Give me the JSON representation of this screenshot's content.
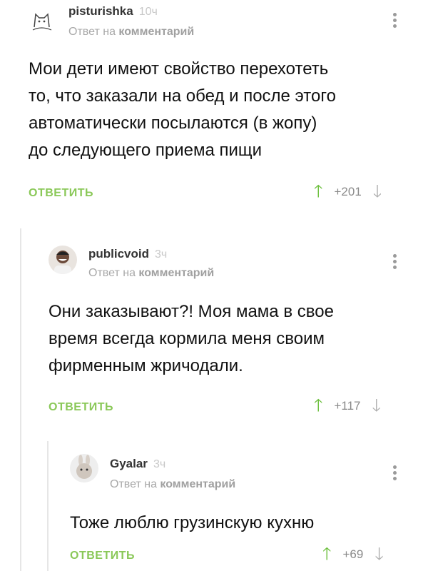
{
  "comments": [
    {
      "username": "pisturishka",
      "time": "10ч",
      "reply_prefix": "Ответ на",
      "reply_target": "комментарий",
      "text": "Мои дети имеют свойство перехотеть\nто, что заказали на обед и после этого\nавтоматически посылаются (в жопу)\nдо следующего приема пищи",
      "reply_label": "ОТВЕТИТЬ",
      "score": "+201"
    },
    {
      "username": "publicvoid",
      "time": "3ч",
      "reply_prefix": "Ответ на",
      "reply_target": "комментарий",
      "text": "Они заказывают?! Моя мама в свое\nвремя всегда кормила меня своим\nфирменным жричодали.",
      "reply_label": "ОТВЕТИТЬ",
      "score": "+117"
    },
    {
      "username": "Gyalar",
      "time": "3ч",
      "reply_prefix": "Ответ на",
      "reply_target": "комментарий",
      "text": "Тоже люблю грузинскую кухню",
      "reply_label": "ОТВЕТИТЬ",
      "score": "+69"
    }
  ],
  "icons": {
    "upvote": "arrow-up-icon",
    "downvote": "arrow-down-icon",
    "more": "more-vertical-icon"
  },
  "colors": {
    "accent": "#8ac858",
    "upvote": "#6cbf3c",
    "muted": "#a8a8a8"
  }
}
